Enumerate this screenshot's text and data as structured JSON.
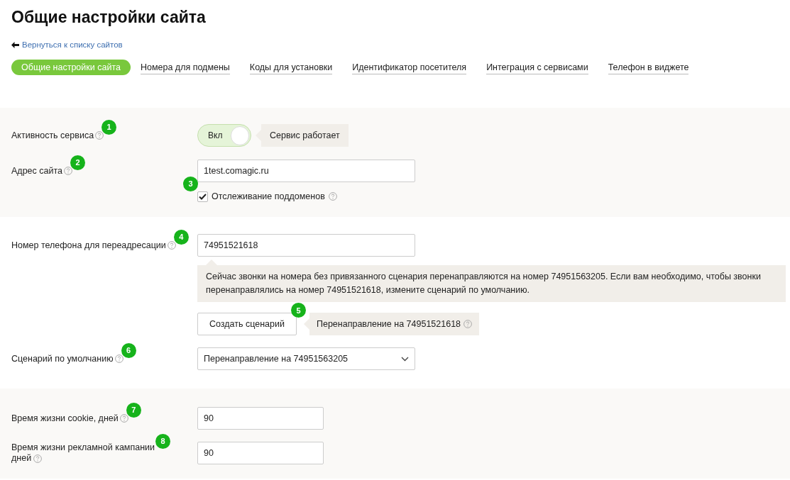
{
  "title": "Общие настройки сайта",
  "back_link": "Вернуться к списку сайтов",
  "tabs": [
    {
      "label": "Общие настройки сайта",
      "selected": true
    },
    {
      "label": "Номера для подмены",
      "selected": false
    },
    {
      "label": "Коды для установки",
      "selected": false
    },
    {
      "label": "Идентификатор посетителя",
      "selected": false
    },
    {
      "label": "Интеграция с сервисами",
      "selected": false
    },
    {
      "label": "Телефон в виджете",
      "selected": false
    }
  ],
  "service_active": {
    "label": "Активность сервиса",
    "badge": "1",
    "toggle_label": "Вкл",
    "on": true,
    "status": "Сервис работает"
  },
  "site_address": {
    "label": "Адрес сайта",
    "badge": "2",
    "value": "1test.comagic.ru"
  },
  "subdomain_tracking": {
    "label": "Отслеживание поддоменов",
    "badge": "3",
    "checked": true
  },
  "forward_phone": {
    "label": "Номер телефона для переадресации",
    "badge": "4",
    "value": "74951521618",
    "notice": "Сейчас звонки на номера без привязанного сценария перенаправляются на номер 74951563205. Если вам необходимо, чтобы звонки перенаправлялись на номер 74951521618, измените сценарий по умолчанию.",
    "create_button": "Создать сценарий",
    "button_badge": "5",
    "redirect_note": "Перенаправление на 74951521618"
  },
  "default_scenario": {
    "label": "Сценарий по умолчанию",
    "badge": "6",
    "value": "Перенаправление на 74951563205"
  },
  "cookie_lifetime": {
    "label": "Время жизни cookie, дней",
    "badge": "7",
    "value": "90"
  },
  "campaign_lifetime": {
    "label_line1": "Время жизни рекламной кампании",
    "label_line2": "дней",
    "badge": "8",
    "value": "90"
  }
}
